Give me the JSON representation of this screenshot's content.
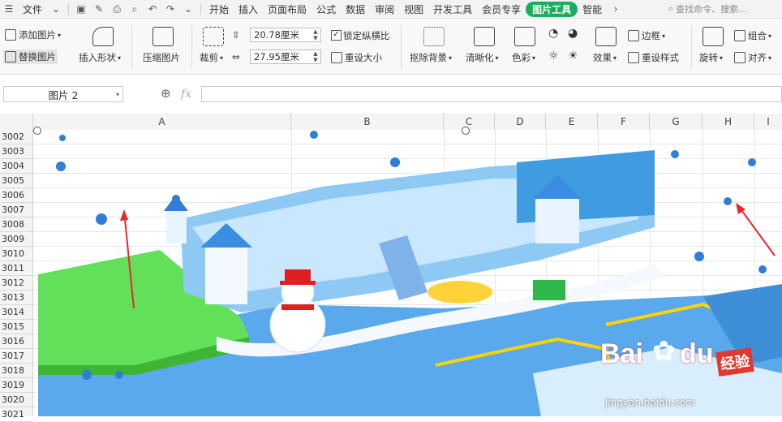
{
  "menubar": {
    "file_label": "文件",
    "tabs": [
      "开始",
      "插入",
      "页面布局",
      "公式",
      "数据",
      "审阅",
      "视图",
      "开发工具",
      "会员专享",
      "图片工具",
      "智能"
    ],
    "active_tab": "图片工具",
    "search_placeholder": "查找命令、搜索..."
  },
  "ribbon": {
    "add_picture": "添加图片",
    "replace_picture": "替换图片",
    "insert_shape": "插入形状",
    "compress_picture": "压缩图片",
    "crop": "裁剪",
    "width_value": "20.78厘米",
    "height_value": "27.95厘米",
    "lock_ratio": "锁定纵横比",
    "reset_size": "重设大小",
    "remove_bg": "抠除背景",
    "sharpen": "清晰化",
    "color": "色彩",
    "effects": "效果",
    "border": "边框",
    "reset_style": "重设样式",
    "rotate": "旋转",
    "group": "组合",
    "align": "对齐"
  },
  "formula": {
    "name_box": "图片 2",
    "fx_label": "fx"
  },
  "columns": [
    "A",
    "B",
    "C",
    "D",
    "E",
    "F",
    "G",
    "H",
    "I"
  ],
  "rows": [
    "3002",
    "3003",
    "3004",
    "3005",
    "3006",
    "3007",
    "3008",
    "3009",
    "3010",
    "3011",
    "3012",
    "3013",
    "3014",
    "3015",
    "3016",
    "3017",
    "3018",
    "3019",
    "3020",
    "3021"
  ],
  "watermark": {
    "brand": "Bai",
    "brand2": "du",
    "slogan": "经验",
    "url": "jingyan.baidu.com"
  },
  "colors": {
    "accent_green": "#1aad5e",
    "snow_blue": "#2f7fd6",
    "floor_green": "#63e05a"
  }
}
